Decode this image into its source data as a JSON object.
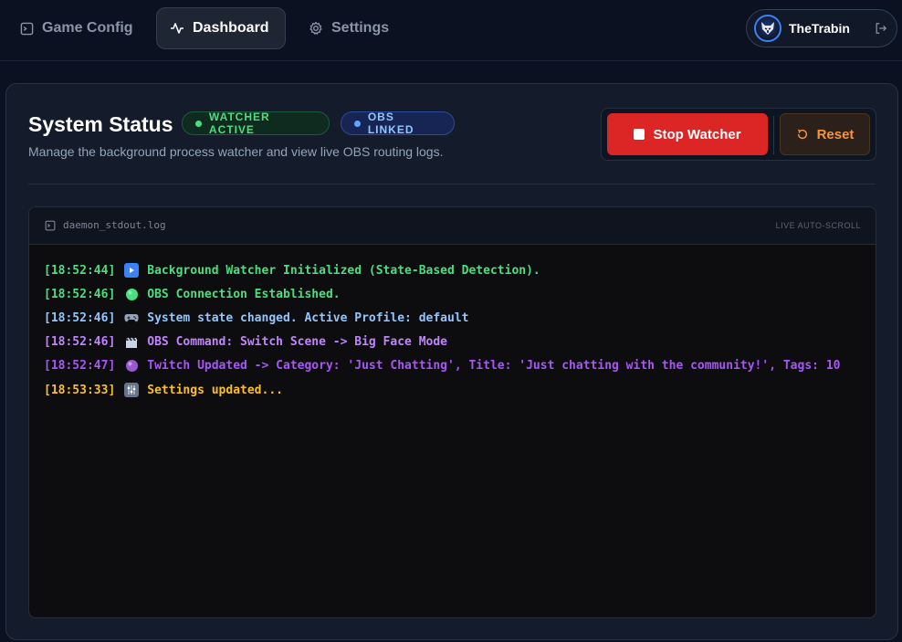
{
  "nav": {
    "tabs": [
      {
        "label": "Game Config",
        "icon": "terminal-icon"
      },
      {
        "label": "Dashboard",
        "icon": "activity-icon"
      },
      {
        "label": "Settings",
        "icon": "gear-icon"
      }
    ],
    "active_tab": "Dashboard",
    "user": {
      "name": "TheTrabin",
      "avatar_icon": "wolf-avatar",
      "logout_icon": "logout-icon"
    }
  },
  "status": {
    "title": "System Status",
    "badges": [
      {
        "label": "WATCHER ACTIVE",
        "color": "#4ade80"
      },
      {
        "label": "OBS LINKED",
        "color": "#93c5fd"
      }
    ],
    "subtitle": "Manage the background process watcher and view live OBS routing logs.",
    "stop_button": "Stop Watcher",
    "reset_button": "Reset"
  },
  "terminal": {
    "filename": "daemon_stdout.log",
    "scroll_label": "LIVE AUTO-SCROLL",
    "lines": [
      {
        "time": "[18:52:44]",
        "icon": "play-icon",
        "text": "Background Watcher Initialized (State-Based Detection).",
        "color": "#4ade80"
      },
      {
        "time": "[18:52:46]",
        "icon": "green-circle-icon",
        "text": "OBS Connection Established.",
        "color": "#4ade80"
      },
      {
        "time": "[18:52:46]",
        "icon": "gamepad-icon",
        "text": "System state changed. Active Profile: default",
        "color": "#93c5fd"
      },
      {
        "time": "[18:52:46]",
        "icon": "clapper-icon",
        "text": "OBS Command: Switch Scene -> Big Face Mode",
        "color": "#c084fc"
      },
      {
        "time": "[18:52:47]",
        "icon": "purple-circle-icon",
        "text": "Twitch Updated -> Category: 'Just Chatting', Title: 'Just chatting with the community!', Tags: 10",
        "color": "#a855f7"
      },
      {
        "time": "[18:53:33]",
        "icon": "control-knobs-icon",
        "text": "Settings updated...",
        "color": "#fbbf24"
      }
    ]
  }
}
